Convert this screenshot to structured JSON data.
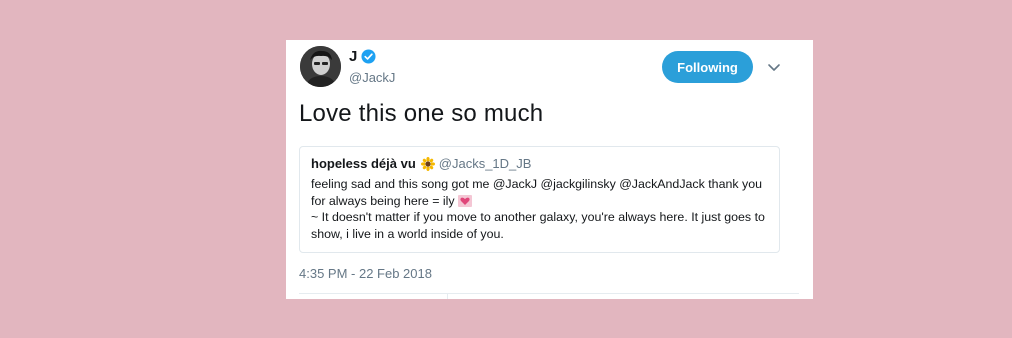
{
  "author": {
    "display_name": "J",
    "handle": "@JackJ",
    "verified": true
  },
  "follow_button": {
    "label": "Following",
    "color": "#2b9fd9"
  },
  "caret_icon": "chevron-down-icon",
  "tweet": {
    "text": "Love this one so much",
    "timestamp": "4:35 PM - 22 Feb 2018"
  },
  "quoted_tweet": {
    "display_name": "hopeless déjà vu",
    "name_emoji": "sunflower-icon",
    "handle": "@Jacks_1D_JB",
    "text_line1": "feeling sad and this song got me @JackJ @jackgilinsky @JackAndJack thank you for always being here = ily",
    "text_emoji": "sparkling-heart-icon",
    "text_line2": "~ It doesn't matter if you move to another galaxy, you're always here. It just goes to show, i live in a world inside of you."
  },
  "colors": {
    "background": "#e2b6bf",
    "card": "#ffffff",
    "secondary_text": "#657786",
    "verified_badge": "#1da1f2"
  }
}
